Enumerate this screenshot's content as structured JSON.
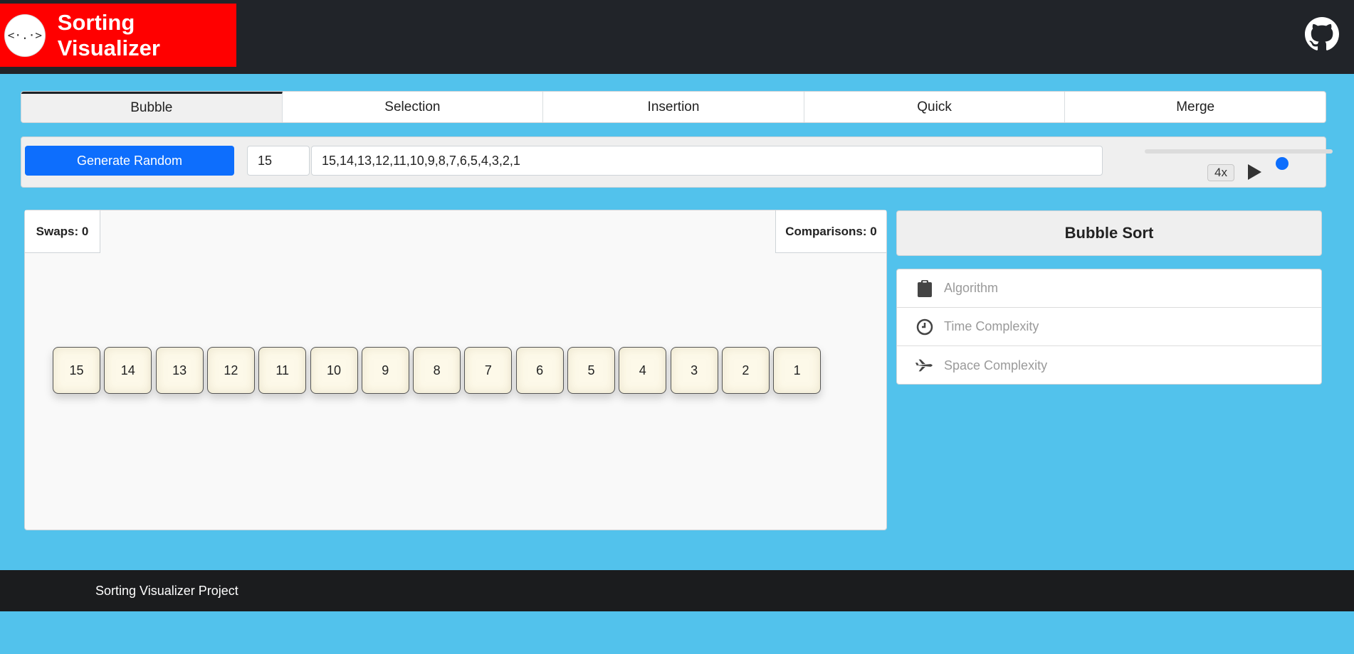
{
  "header": {
    "logo_text": "<·.·>",
    "title": "Sorting Visualizer",
    "github_icon": "github-icon"
  },
  "tabs": [
    {
      "label": "Bubble",
      "active": true
    },
    {
      "label": "Selection",
      "active": false
    },
    {
      "label": "Insertion",
      "active": false
    },
    {
      "label": "Quick",
      "active": false
    },
    {
      "label": "Merge",
      "active": false
    }
  ],
  "controls": {
    "generate_label": "Generate Random",
    "count_value": "15",
    "array_value": "15,14,13,12,11,10,9,8,7,6,5,4,3,2,1",
    "speed_label": "4x",
    "speed_level": 0.73,
    "play_icon": "play-icon"
  },
  "stats": {
    "swaps": "Swaps: 0",
    "comparisons": "Comparisons: 0"
  },
  "array": [
    15,
    14,
    13,
    12,
    11,
    10,
    9,
    8,
    7,
    6,
    5,
    4,
    3,
    2,
    1
  ],
  "sidebar": {
    "title": "Bubble Sort",
    "items": [
      {
        "label": "Algorithm",
        "icon": "clipboard-icon"
      },
      {
        "label": "Time Complexity",
        "icon": "clock-icon"
      },
      {
        "label": "Space Complexity",
        "icon": "plane-icon"
      }
    ]
  },
  "footer": {
    "text": "Sorting Visualizer Project"
  },
  "colors": {
    "background": "#52c2ec",
    "navbar": "#212429",
    "brand": "#ff0000",
    "accent": "#0d6efd",
    "footer": "#1b1c1e"
  }
}
